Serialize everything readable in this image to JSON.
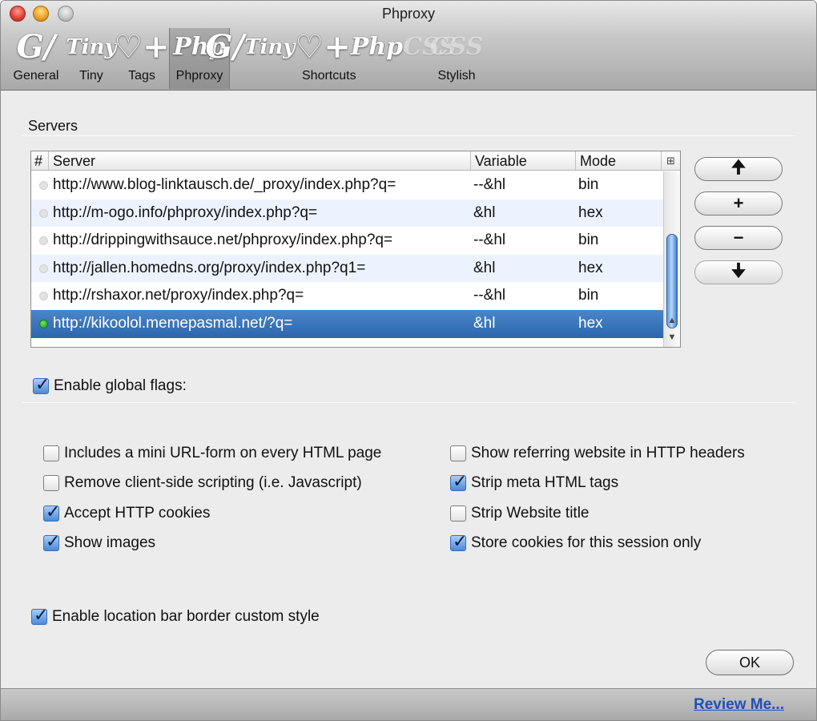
{
  "window": {
    "title": "Phproxy"
  },
  "toolbar": {
    "items": [
      {
        "label": "General",
        "icon": "general-g-icon",
        "glyph": "G"
      },
      {
        "label": "Tiny",
        "icon": "tiny-icon",
        "glyph": "Tiny"
      },
      {
        "label": "Tags",
        "icon": "tags-heart-plus-icon",
        "glyph": "♡+"
      },
      {
        "label": "Phproxy",
        "icon": "phproxy-icon",
        "glyph": "Php",
        "selected": true
      },
      {
        "label": "Shortcuts",
        "icon": "shortcuts-icon",
        "glyph": "G Tiny ♡+ Php"
      },
      {
        "label": "Stylish",
        "icon": "stylish-css-icon",
        "glyph": "CSS"
      }
    ]
  },
  "servers_section": {
    "label": "Servers"
  },
  "table": {
    "columns": {
      "num": "#",
      "server": "Server",
      "variable": "Variable",
      "mode": "Mode"
    },
    "rows": [
      {
        "server": "http://www.blog-linktausch.de/_proxy/index.php?q=",
        "variable": "--&hl",
        "mode": "bin",
        "active": false
      },
      {
        "server": "http://m-ogo.info/phproxy/index.php?q=",
        "variable": "&hl",
        "mode": "hex",
        "active": false
      },
      {
        "server": "http://drippingwithsauce.net/phproxy/index.php?q=",
        "variable": "--&hl",
        "mode": "bin",
        "active": false
      },
      {
        "server": "http://jallen.homedns.org/proxy/index.php?q1=",
        "variable": "&hl",
        "mode": "hex",
        "active": false
      },
      {
        "server": "http://rshaxor.net/proxy/index.php?q=",
        "variable": "--&hl",
        "mode": "bin",
        "active": false
      },
      {
        "server": "http://kikoolol.memepasmal.net/?q=",
        "variable": "&hl",
        "mode": "hex",
        "active": true,
        "selected": true
      }
    ]
  },
  "side_buttons": {
    "up": "🠉",
    "add": "+",
    "remove": "−",
    "down": "🠋"
  },
  "global_flags": {
    "label": "Enable global flags:",
    "checked": true
  },
  "flags_left": [
    {
      "label": "Includes a mini URL-form on every HTML page",
      "checked": false
    },
    {
      "label": "Remove client-side scripting (i.e. Javascript)",
      "checked": false
    },
    {
      "label": "Accept HTTP cookies",
      "checked": true
    },
    {
      "label": "Show images",
      "checked": true
    }
  ],
  "flags_right": [
    {
      "label": "Show referring website in HTTP headers",
      "checked": false
    },
    {
      "label": "Strip meta HTML tags",
      "checked": true
    },
    {
      "label": "Strip Website title",
      "checked": false
    },
    {
      "label": "Store cookies for this session only",
      "checked": true
    }
  ],
  "location_bar": {
    "label": "Enable location bar border custom style",
    "checked": true
  },
  "ok_button": {
    "label": "OK"
  },
  "footer": {
    "review_link": "Review Me..."
  },
  "colors": {
    "selection": "#2c65ad",
    "alt_row": "#edf3fe",
    "link": "#1f50b5"
  }
}
